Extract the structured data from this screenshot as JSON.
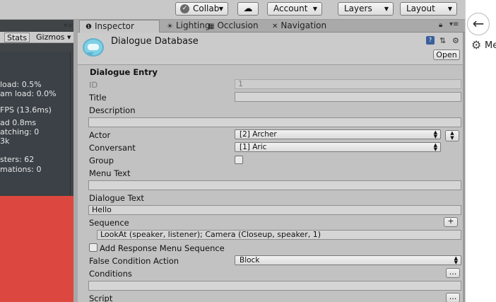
{
  "toolbar": {
    "collab_label": "Collab",
    "account_label": "Account",
    "layers_label": "Layers",
    "layout_label": "Layout"
  },
  "tabs": [
    {
      "label": "Inspector",
      "icon": "info-icon",
      "active": true
    },
    {
      "label": "Lighting",
      "icon": "lighting-icon",
      "active": false
    },
    {
      "label": "Occlusion",
      "icon": "occlusion-icon",
      "active": false
    },
    {
      "label": "Navigation",
      "icon": "navigation-icon",
      "active": false
    }
  ],
  "game_view": {
    "tabs": {
      "stats": "Stats",
      "gizmos": "Gizmos"
    },
    "stats_lines": [
      "load: 0.5%",
      "am load: 0.0%",
      "FPS (13.6ms)",
      "ad 0.8ms",
      "atching: 0",
      "3k",
      "sters: 62",
      "mations: 0"
    ]
  },
  "inspector": {
    "asset_title": "Dialogue Database",
    "open_label": "Open",
    "section_title": "Dialogue Entry",
    "fields": {
      "id_label": "ID",
      "id_value": "1",
      "title_label": "Title",
      "title_value": "",
      "description_label": "Description",
      "description_value": "",
      "actor_label": "Actor",
      "actor_value": "[2] Archer",
      "conversant_label": "Conversant",
      "conversant_value": "[1] Aric",
      "group_label": "Group",
      "menu_text_label": "Menu Text",
      "menu_text_value": "",
      "dialogue_text_label": "Dialogue Text",
      "dialogue_text_value": "Hello",
      "sequence_label": "Sequence",
      "sequence_value": "LookAt (speaker, listener); Camera (Closeup, speaker, 1)",
      "add_response_label": "Add Response Menu Sequence",
      "false_condition_label": "False Condition Action",
      "false_condition_value": "Block",
      "conditions_label": "Conditions",
      "conditions_value": "",
      "script_label": "Script"
    },
    "buttons": {
      "plus": "+",
      "ellipsis": "..."
    }
  },
  "side": {
    "text": "Me"
  },
  "colors": {
    "game_red": "#dc483f",
    "stats_bg": "#3b4147",
    "inspector_bg": "#c2c2c2"
  }
}
